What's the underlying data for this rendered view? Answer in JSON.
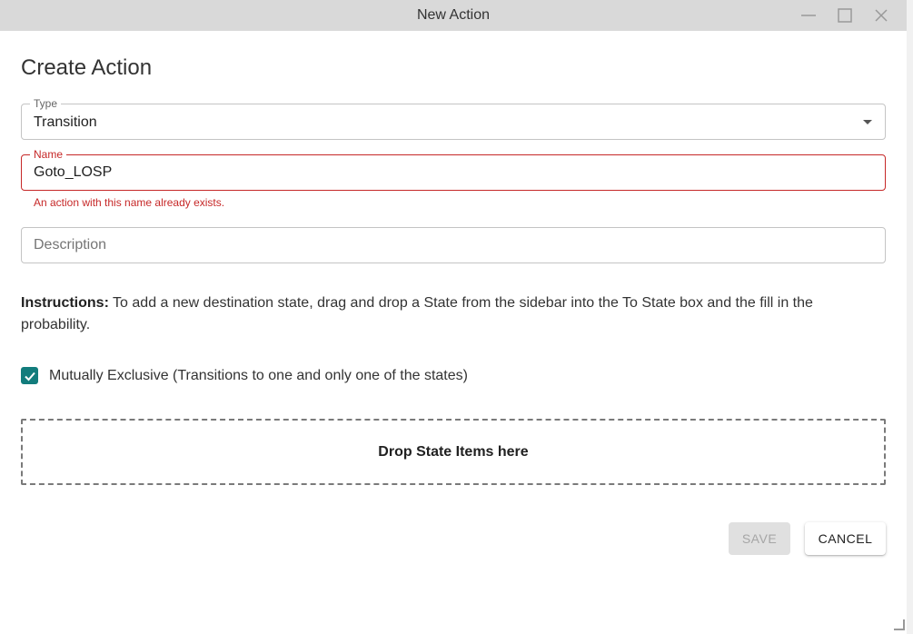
{
  "window": {
    "title": "New Action",
    "minimize_icon": "minimize-icon",
    "maximize_icon": "maximize-icon",
    "close_icon": "close-icon"
  },
  "page": {
    "title": "Create Action"
  },
  "form": {
    "type": {
      "label": "Type",
      "value": "Transition"
    },
    "name": {
      "label": "Name",
      "value": "Goto_LOSP",
      "error": "An action with this name already exists."
    },
    "description": {
      "placeholder": "Description",
      "value": ""
    },
    "instructions": {
      "label": "Instructions:",
      "text": " To add a new destination state, drag and drop a State from the sidebar into the To State box and the fill in the probability."
    },
    "mutually_exclusive": {
      "checked": true,
      "label": "Mutually Exclusive (Transitions to one and only one of the states)"
    },
    "dropzone": {
      "text": "Drop State Items here"
    }
  },
  "actions": {
    "save_label": "SAVE",
    "cancel_label": "CANCEL"
  },
  "colors": {
    "accent": "#127c7c",
    "error": "#c62828",
    "titlebar": "#d9d9d9"
  }
}
